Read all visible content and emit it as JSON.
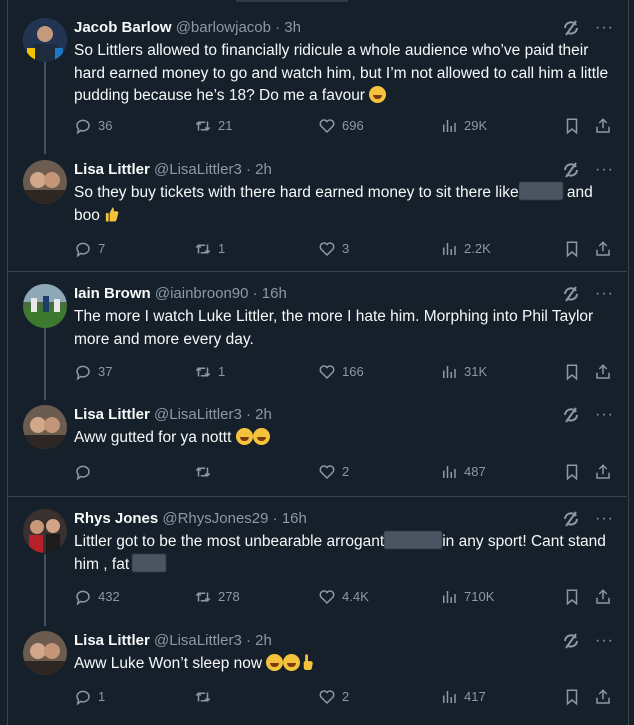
{
  "tweets": [
    {
      "name": "Jacob Barlow",
      "handle": "@barlowjacob · 3h",
      "text_parts": [
        "So Littlers allowed to financially ridicule a whole audience who’ve paid their hard earned money to go and watch him, but I’m not allowed to call him a little pudding because he’s 18? Do me a favour"
      ],
      "reply_count": "36",
      "retweet_count": "21",
      "like_count": "696",
      "view_count": "29K"
    },
    {
      "name": "Lisa Littler",
      "handle": "@LisaLittler3 · 2h",
      "text_parts": [
        "So they buy tickets with there hard earned money to sit there like",
        "and",
        "boo"
      ],
      "reply_count": "7",
      "retweet_count": "1",
      "like_count": "3",
      "view_count": "2.2K"
    },
    {
      "name": "Iain Brown",
      "handle": "@iainbroon90 · 16h",
      "text_parts": [
        "The more I watch Luke Littler, the more I hate him. Morphing into Phil Taylor more and more every day."
      ],
      "reply_count": "37",
      "retweet_count": "1",
      "like_count": "166",
      "view_count": "31K"
    },
    {
      "name": "Lisa Littler",
      "handle": "@LisaLittler3 · 2h",
      "text_parts": [
        "Aww gutted for ya nottt"
      ],
      "reply_count": "",
      "retweet_count": "",
      "like_count": "2",
      "view_count": "487"
    },
    {
      "name": "Rhys Jones",
      "handle": "@RhysJones29 · 16h",
      "text_parts": [
        "Littler got to be the most unbearable arrogant",
        "in any sport! Cant stand him , fat"
      ],
      "reply_count": "432",
      "retweet_count": "278",
      "like_count": "4.4K",
      "view_count": "710K"
    },
    {
      "name": "Lisa Littler",
      "handle": "@LisaLittler3 · 2h",
      "text_parts": [
        "Aww Luke Won’t sleep now"
      ],
      "reply_count": "1",
      "retweet_count": "",
      "like_count": "2",
      "view_count": "417"
    }
  ],
  "icons": {
    "reply": "reply-icon",
    "retweet": "retweet-icon",
    "like": "heart-icon",
    "views": "views-icon",
    "bookmark": "bookmark-icon",
    "share": "share-icon",
    "grok": "grok-icon",
    "more": "more-icon"
  },
  "colors": {
    "background": "#15202b",
    "text": "#f7f9f9",
    "muted": "#8b98a5",
    "divider": "#38444d"
  }
}
